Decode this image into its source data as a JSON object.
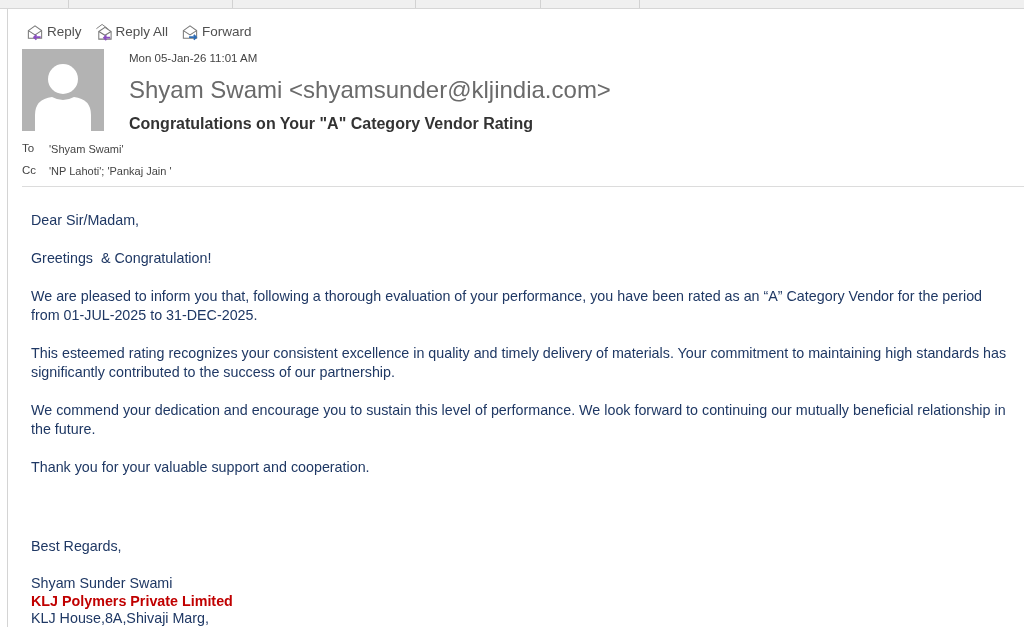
{
  "actions": [
    {
      "label": "Reply",
      "kind": "reply"
    },
    {
      "label": "Reply All",
      "kind": "reply_all"
    },
    {
      "label": "Forward",
      "kind": "forward"
    }
  ],
  "header": {
    "date": "Mon 05-Jan-26 11:01 AM",
    "sender": "Shyam Swami <shyamsunder@kljindia.com>",
    "subject": "Congratulations on Your \"A\" Category Vendor Rating",
    "recipients": [
      {
        "label": "To",
        "value": "'Shyam Swami'"
      },
      {
        "label": "Cc",
        "value": "'NP Lahoti'; 'Pankaj Jain '"
      }
    ]
  },
  "body": {
    "paragraphs": [
      "Dear Sir/Madam,",
      "Greetings  & Congratulation!",
      "We are pleased to inform you that, following a thorough evaluation of your performance, you have been rated as an “A” Category Vendor for the period from 01-JUL-2025 to 31-DEC-2025.",
      "This esteemed rating recognizes your consistent excellence in quality and timely delivery of materials. Your commitment to maintaining high standards has significantly contributed to the success of our partnership.",
      "We commend your dedication and encourage you to sustain this level of performance. We look forward to continuing our mutually beneficial relationship in the future.",
      "Thank you for your valuable support and cooperation."
    ],
    "closing": "Best Regards,",
    "signature": [
      {
        "text": "Shyam Sunder Swami",
        "kind": "name"
      },
      {
        "text": "KLJ Polymers Private Limited",
        "kind": "company"
      },
      {
        "text": "KLJ House,8A,Shivaji Marg,",
        "kind": "address"
      }
    ]
  }
}
